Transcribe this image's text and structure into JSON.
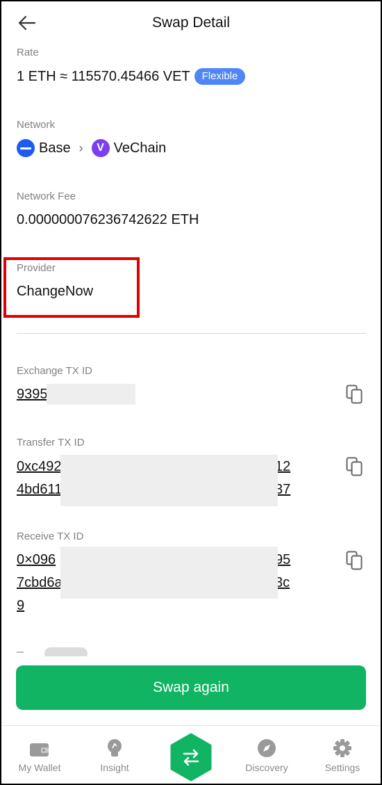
{
  "header": {
    "title": "Swap Detail"
  },
  "rate": {
    "label": "Rate",
    "value": "1 ETH ≈ 115570.45466 VET",
    "badge": "Flexible"
  },
  "network": {
    "label": "Network",
    "from": "Base",
    "to": "VeChain"
  },
  "network_fee": {
    "label": "Network Fee",
    "value": "0.000000076236742622 ETH"
  },
  "provider": {
    "label": "Provider",
    "value": "ChangeNow"
  },
  "exchange_tx": {
    "label": "Exchange TX ID",
    "line1": "9395"
  },
  "transfer_tx": {
    "label": "Transfer TX ID",
    "line1_start": "0xc492",
    "line1_end": "12",
    "line2_start": "4bd611",
    "line2_end": "37"
  },
  "receive_tx": {
    "label": "Receive TX ID",
    "line1_start": "0×096",
    "line1_end": "95",
    "line2_start": "7cbd6a",
    "line2_end": "3c",
    "line3": "9"
  },
  "swap_again": "Swap again",
  "tabs": {
    "wallet": "My Wallet",
    "insight": "Insight",
    "discovery": "Discovery",
    "settings": "Settings"
  },
  "colors": {
    "accent_green": "#10b462",
    "badge_blue": "#4e86f5",
    "highlight_red": "#e00000"
  }
}
